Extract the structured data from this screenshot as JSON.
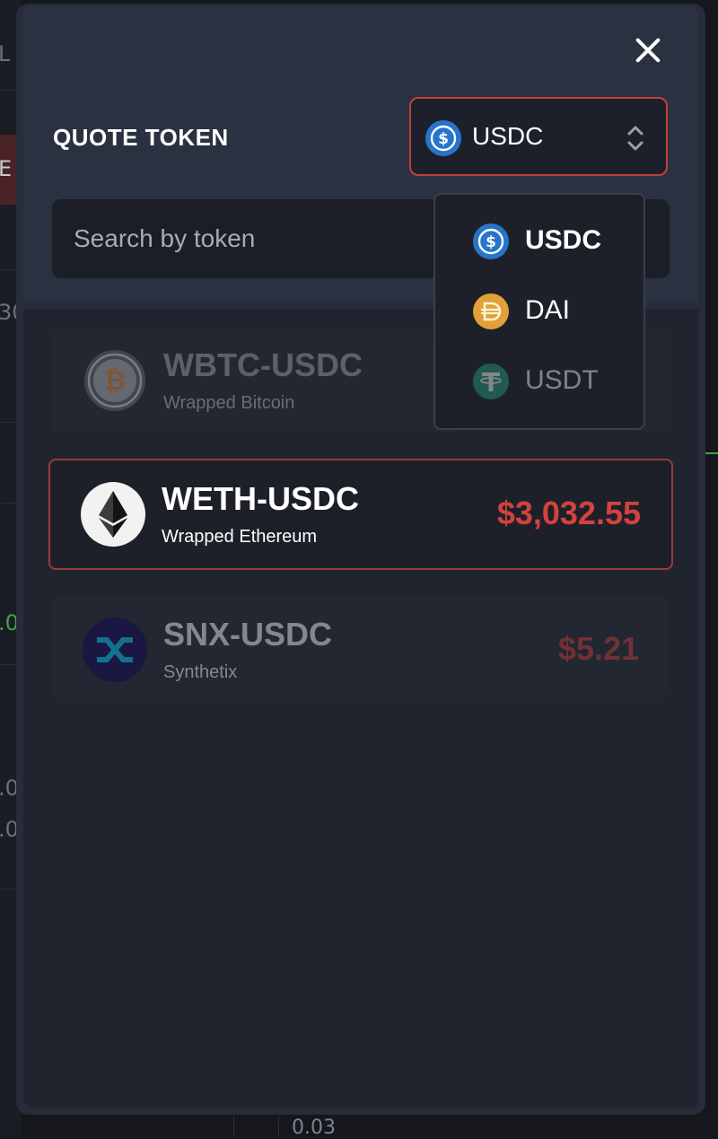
{
  "background": {
    "fragments": [
      "L",
      "E",
      "30",
      ".0",
      ".0",
      ".0"
    ],
    "bottom_value": "0.03"
  },
  "modal": {
    "close_icon": "close-icon",
    "quote_label": "QUOTE TOKEN",
    "quote_select": {
      "value": "USDC",
      "icon": "usdc-icon"
    },
    "search_placeholder": "Search by token",
    "dropdown": [
      {
        "label": "USDC",
        "icon": "usdc-icon",
        "state": "selected"
      },
      {
        "label": "DAI",
        "icon": "dai-icon",
        "state": "normal"
      },
      {
        "label": "USDT",
        "icon": "usdt-icon",
        "state": "disabled"
      }
    ],
    "tokens": [
      {
        "pair": "WBTC-USDC",
        "name": "Wrapped Bitcoin",
        "price": "",
        "icon": "bitcoin-icon",
        "state": "dimmed"
      },
      {
        "pair": "WETH-USDC",
        "name": "Wrapped Ethereum",
        "price": "$3,032.55",
        "icon": "ethereum-icon",
        "state": "selected"
      },
      {
        "pair": "SNX-USDC",
        "name": "Synthetix",
        "price": "$5.21",
        "icon": "synthetix-icon",
        "state": "dimmed"
      }
    ]
  },
  "colors": {
    "accent": "#c0413b",
    "price": "#d3423e",
    "modal_bg": "#20242f",
    "usdc": "#2775ca",
    "dai": "#f5ac37",
    "usdt": "#26a17b"
  }
}
